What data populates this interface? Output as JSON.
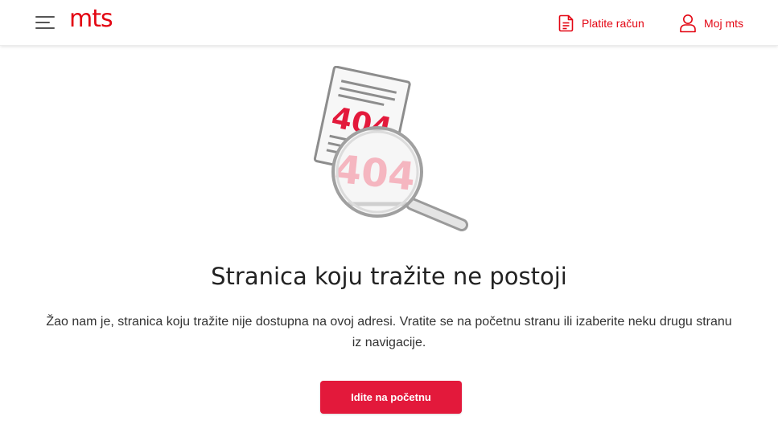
{
  "header": {
    "logo": "mts",
    "pay_bill": {
      "label": "Platite račun",
      "icon": "document-icon"
    },
    "account": {
      "label": "Moj mts",
      "icon": "user-icon"
    },
    "menu_icon": "hamburger-icon"
  },
  "illustration": {
    "paper_text": "404",
    "magnified_text": "404",
    "icon": "magnifier-404-illustration"
  },
  "main": {
    "title": "Stranica koju tražite ne postoji",
    "description": "Žao nam je, stranica koju tražite nije dostupna na ovoj adresi. Vratite se na početnu stranu ili izaberite neku drugu stranu iz navigacije.",
    "cta_label": "Idite na početnu"
  },
  "colors": {
    "brand": "#e30613",
    "button": "#e3193b",
    "text": "#222222"
  }
}
